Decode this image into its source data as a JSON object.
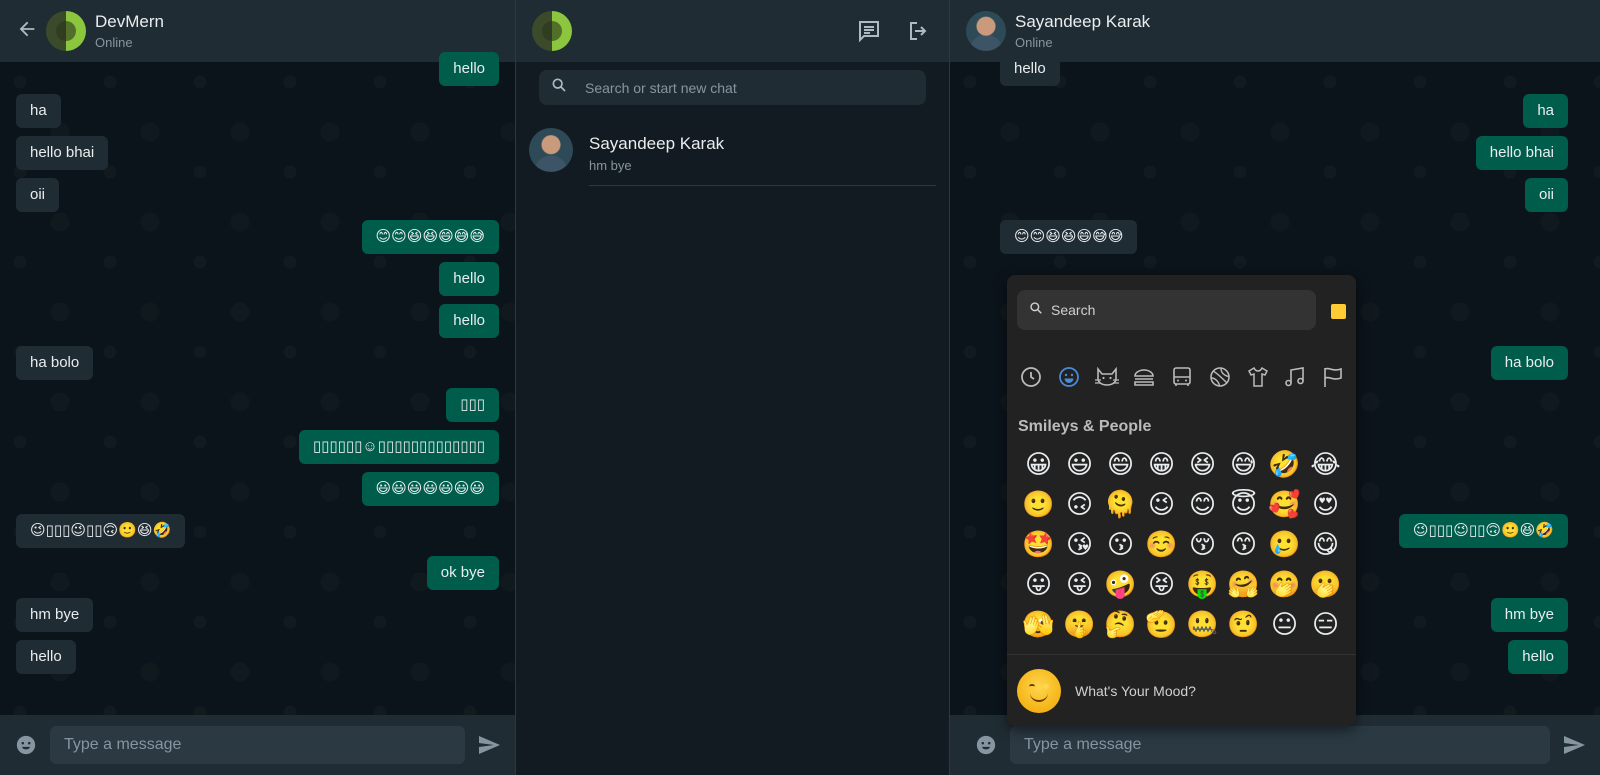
{
  "left_chat": {
    "header": {
      "name": "DevMern",
      "status": "Online"
    },
    "messages": [
      {
        "dir": "out",
        "text": "hello"
      },
      {
        "dir": "in",
        "text": "ha"
      },
      {
        "dir": "in",
        "text": "hello bhai"
      },
      {
        "dir": "in",
        "text": "oii"
      },
      {
        "dir": "out",
        "text": "😊😊😆😆😄😅😅"
      },
      {
        "dir": "out",
        "text": "hello"
      },
      {
        "dir": "out",
        "text": "hello"
      },
      {
        "dir": "in",
        "text": "ha bolo"
      },
      {
        "dir": "out",
        "text": "▯▯▯"
      },
      {
        "dir": "out",
        "text": "▯▯▯▯▯▯☺▯▯▯▯▯▯▯▯▯▯▯▯▯"
      },
      {
        "dir": "out",
        "text": "😃😃😃😃😃😃😃"
      },
      {
        "dir": "in",
        "text": "😉▯▯▯😉▯▯🙃🙂😆🤣"
      },
      {
        "dir": "out",
        "text": "ok bye"
      },
      {
        "dir": "in",
        "text": "hm bye"
      },
      {
        "dir": "in",
        "text": "hello"
      }
    ],
    "composer": {
      "placeholder": "Type a message"
    }
  },
  "sidebar": {
    "search": {
      "placeholder": "Search or start new chat"
    },
    "contacts": [
      {
        "name": "Sayandeep Karak",
        "last_message": "hm bye"
      }
    ],
    "icons": [
      "chat-icon",
      "logout-icon"
    ]
  },
  "right_chat": {
    "header": {
      "name": "Sayandeep Karak",
      "status": "Online"
    },
    "messages": [
      {
        "dir": "in",
        "text": "hello"
      },
      {
        "dir": "out",
        "text": "ha"
      },
      {
        "dir": "out",
        "text": "hello bhai"
      },
      {
        "dir": "out",
        "text": "oii"
      },
      {
        "dir": "in",
        "text": "😊😊😆😆😄😅😅"
      },
      {
        "dir": "in",
        "text": ""
      },
      {
        "dir": "in",
        "text": ""
      },
      {
        "dir": "out",
        "text": "ha bolo"
      },
      {
        "dir": "in",
        "text": ""
      },
      {
        "dir": "in",
        "text": ""
      },
      {
        "dir": "in",
        "text": ""
      },
      {
        "dir": "out",
        "text": "😉▯▯▯😉▯▯🙃🙂😆🤣"
      },
      {
        "dir": "in",
        "text": ""
      },
      {
        "dir": "out",
        "text": "hm bye"
      },
      {
        "dir": "out",
        "text": "hello"
      }
    ],
    "composer": {
      "placeholder": "Type a message"
    }
  },
  "emoji_picker": {
    "search_placeholder": "Search",
    "skin_tone_color": "#ffcc33",
    "categories": [
      "clock-icon",
      "smiley-icon",
      "cat-icon",
      "burger-icon",
      "bus-icon",
      "ball-icon",
      "shirt-icon",
      "music-icon",
      "flag-icon"
    ],
    "active_category": "smiley-icon",
    "section_title": "Smileys & People",
    "emojis": [
      "😀",
      "😃",
      "😄",
      "😁",
      "😆",
      "😅",
      "🤣",
      "😂",
      "🙂",
      "🙃",
      "🫠",
      "😉",
      "😊",
      "😇",
      "🥰",
      "😍",
      "🤩",
      "😘",
      "😗",
      "☺️",
      "😚",
      "😙",
      "🥲",
      "😋",
      "😛",
      "😜",
      "🤪",
      "😝",
      "🤑",
      "🤗",
      "🤭",
      "🫢",
      "🫣",
      "🤫",
      "🤔",
      "🫡",
      "🤐",
      "🤨",
      "😐",
      "😑"
    ],
    "footer_text": "What's Your Mood?"
  },
  "colors": {
    "outgoing_bubble": "#005c4b",
    "incoming_bubble": "#202c33",
    "header": "#202c33",
    "background": "#0b141a",
    "accent": "#4a8bd7"
  }
}
